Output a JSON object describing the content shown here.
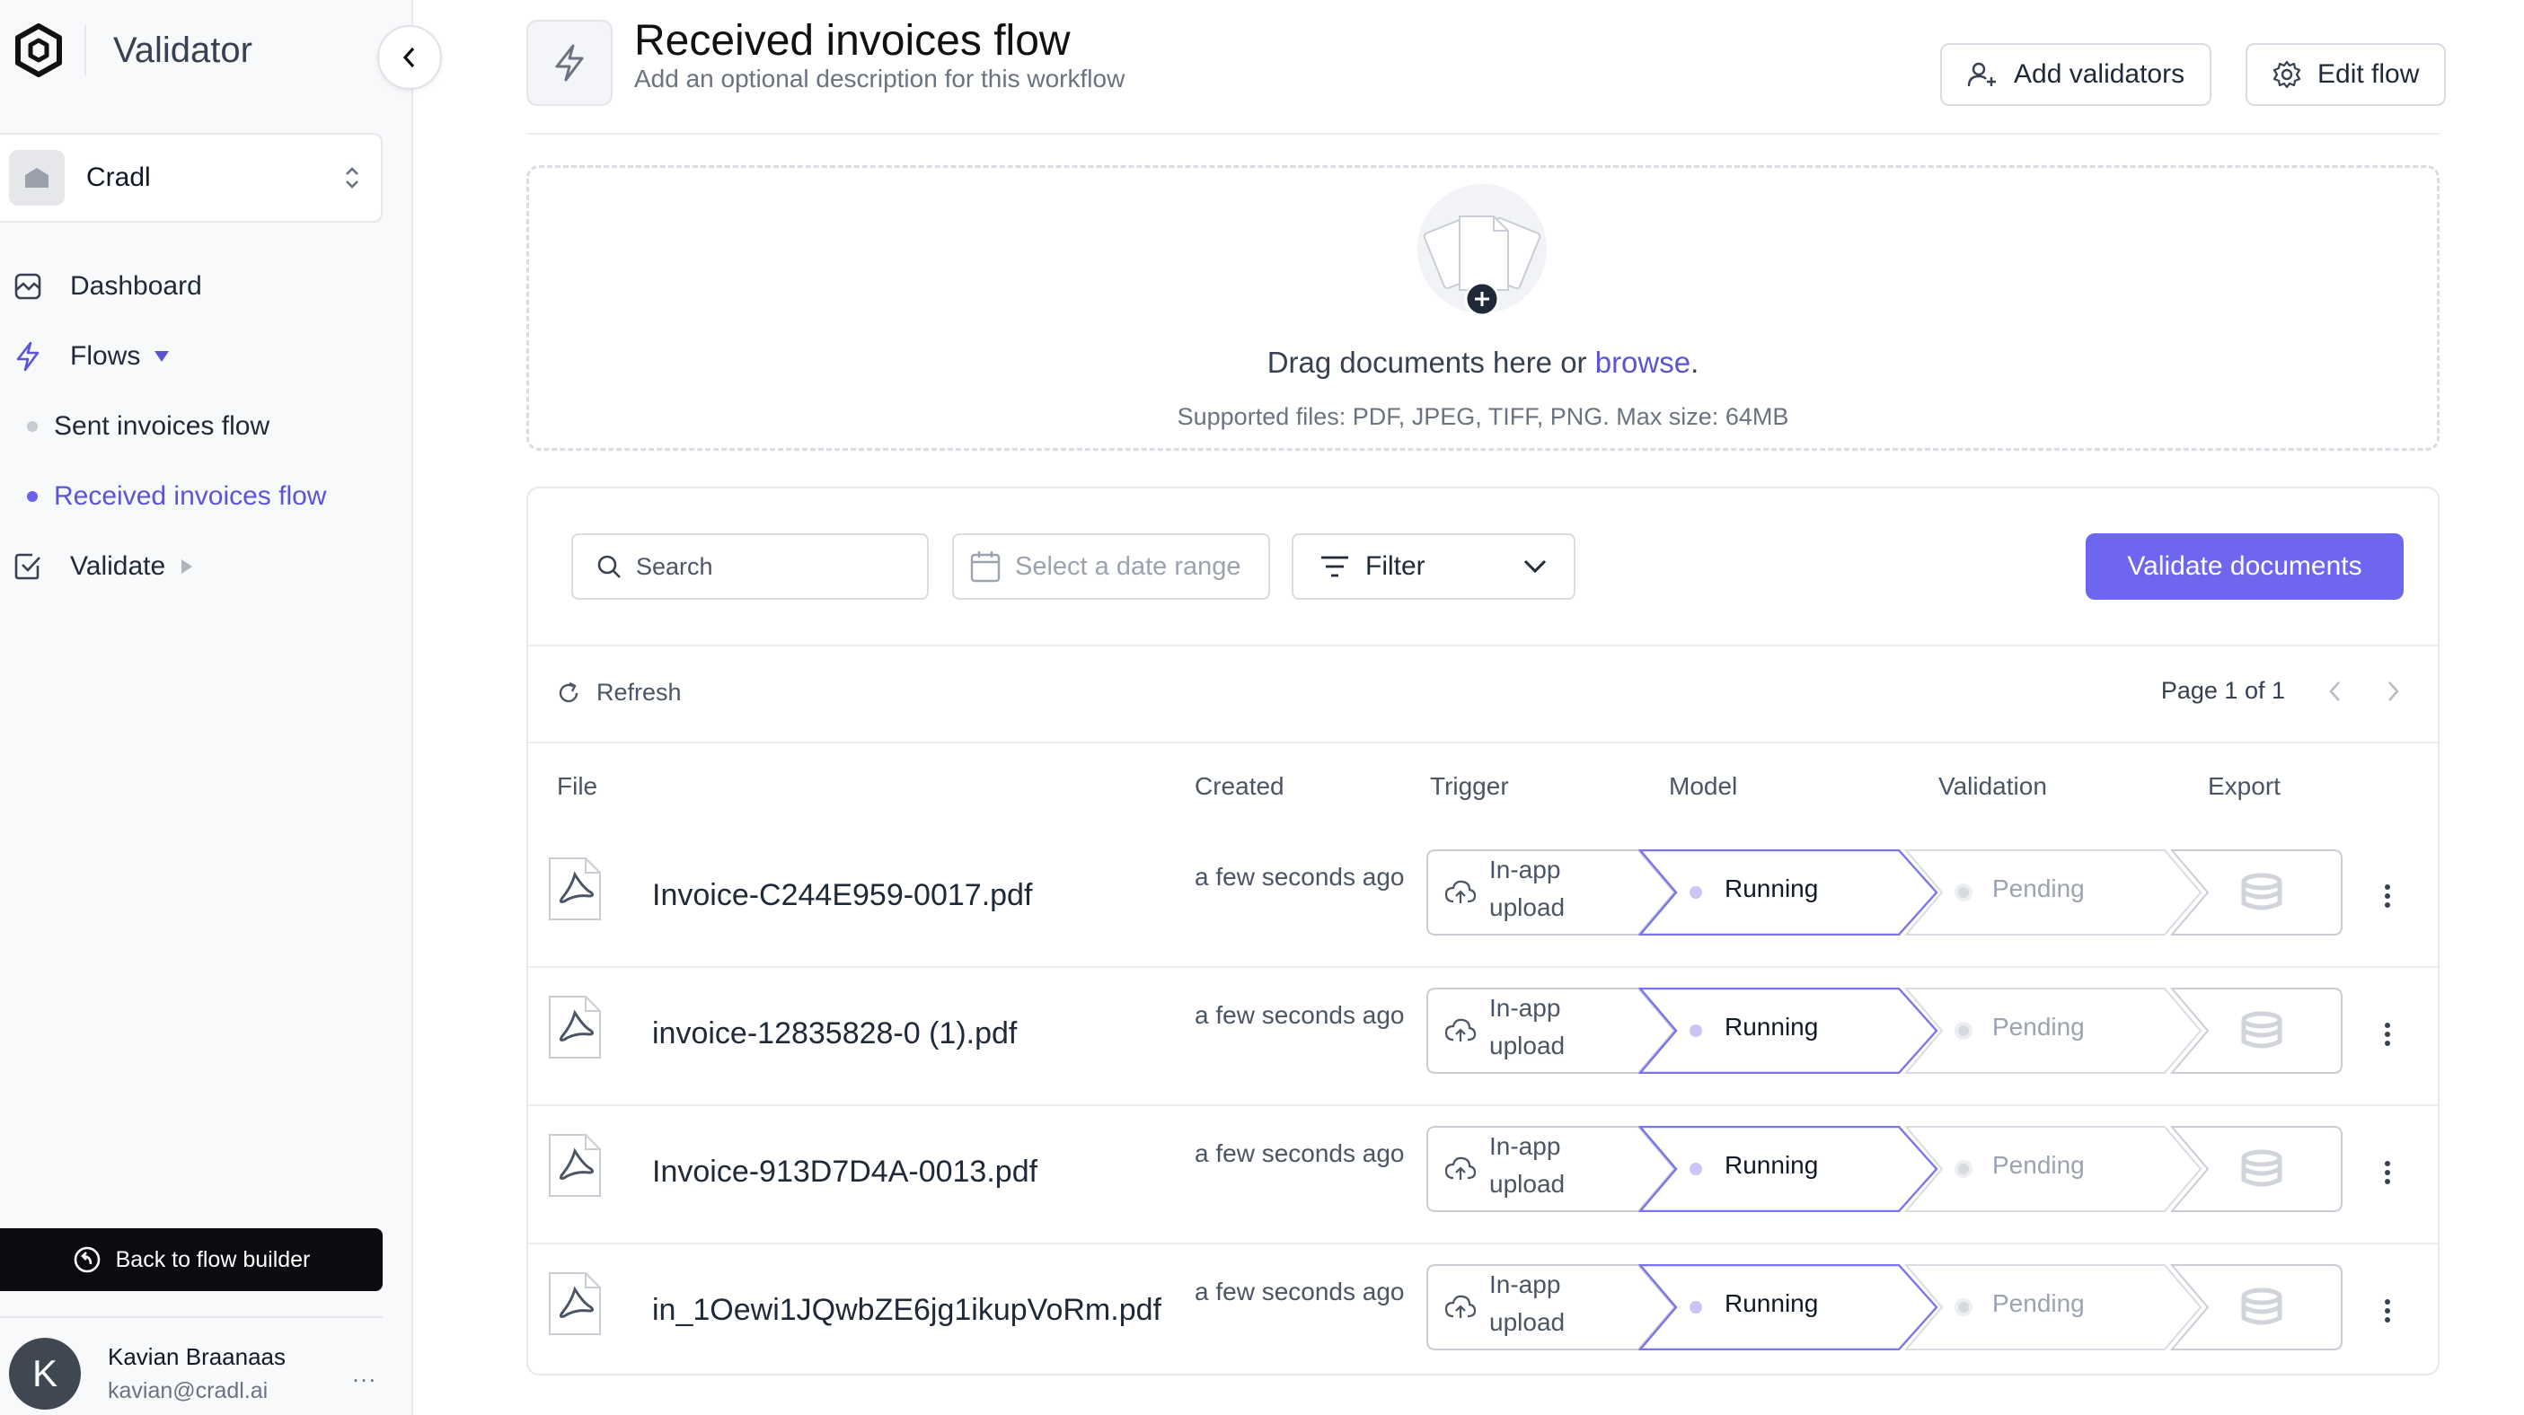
{
  "app": {
    "title": "Validator"
  },
  "sidebar": {
    "workspace": "Cradl",
    "nav": {
      "dashboard": "Dashboard",
      "flows": "Flows",
      "flow_items": [
        "Sent invoices flow",
        "Received invoices flow"
      ],
      "active_flow_index": 1,
      "validate": "Validate"
    },
    "back_button": "Back to flow builder",
    "user": {
      "initial": "K",
      "name": "Kavian Braanaas",
      "email": "kavian@cradl.ai",
      "more": "..."
    }
  },
  "header": {
    "title": "Received invoices flow",
    "description": "Add an optional description for this workflow",
    "add_validators": "Add validators",
    "edit_flow": "Edit flow"
  },
  "dropzone": {
    "text_prefix": "Drag documents here or ",
    "browse": "browse",
    "text_suffix": ".",
    "supported": "Supported files: PDF, JPEG, TIFF, PNG. Max size: 64MB"
  },
  "toolbar": {
    "search_placeholder": "Search",
    "date_placeholder": "Select a date range",
    "filter_label": "Filter",
    "validate_button": "Validate documents"
  },
  "subbar": {
    "refresh": "Refresh",
    "page": "Page 1 of 1"
  },
  "table": {
    "columns": {
      "file": "File",
      "created": "Created",
      "trigger": "Trigger",
      "model": "Model",
      "validation": "Validation",
      "export": "Export"
    },
    "rows": [
      {
        "file": "Invoice-C244E959-0017.pdf",
        "created": "a few seconds ago",
        "trigger": "In-app upload",
        "model": "Running",
        "validation": "Pending"
      },
      {
        "file": "invoice-12835828-0 (1).pdf",
        "created": "a few seconds ago",
        "trigger": "In-app upload",
        "model": "Running",
        "validation": "Pending"
      },
      {
        "file": "Invoice-913D7D4A-0013.pdf",
        "created": "a few seconds ago",
        "trigger": "In-app upload",
        "model": "Running",
        "validation": "Pending"
      },
      {
        "file": "in_1Oewi1JQwbZE6jg1ikupVoRm.pdf",
        "created": "a few seconds ago",
        "trigger": "In-app upload",
        "model": "Running",
        "validation": "Pending"
      }
    ]
  },
  "colors": {
    "accent": "#6e66ee",
    "accent_text": "#5b55d6",
    "running_border": "#7b74ec",
    "pending_border": "#d9dce2"
  }
}
